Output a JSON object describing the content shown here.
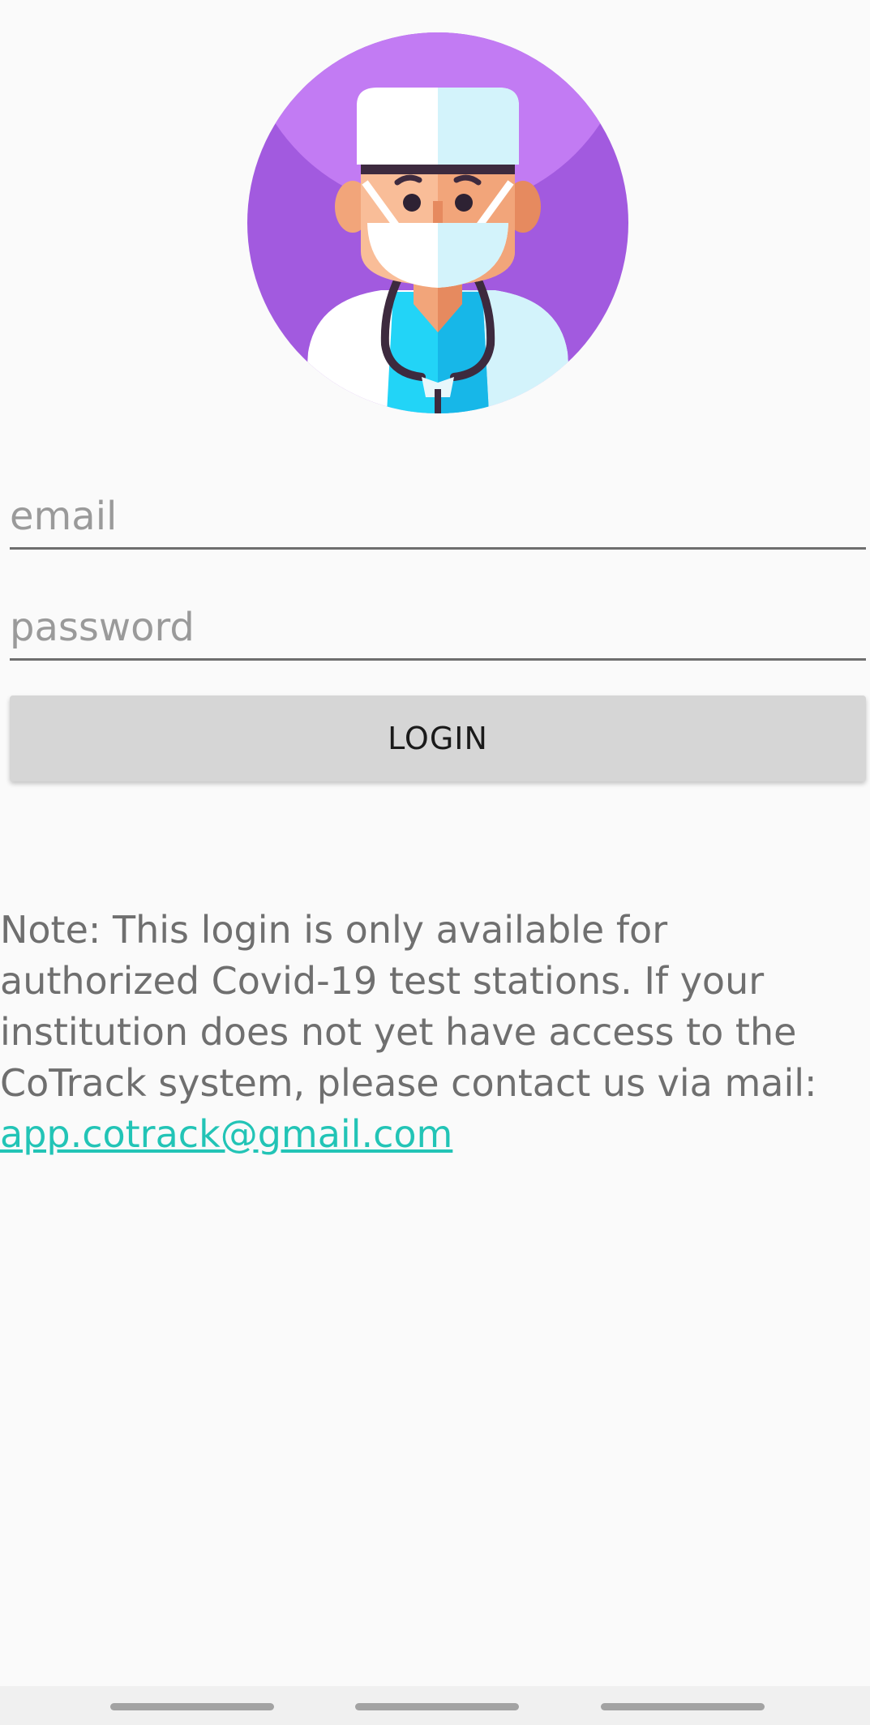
{
  "app": {
    "avatar_icon": "doctor-with-mask-icon"
  },
  "login_form": {
    "email_placeholder": "email",
    "password_placeholder": "password",
    "login_label": "LOGIN"
  },
  "note": {
    "text": "Note: This login is only available for authorized Covid-19 test stations. If your institution does not yet have access to the CoTrack system, please contact us via mail: ",
    "email_link": "app.cotrack@gmail.com"
  },
  "colors": {
    "avatar_background": "#a25adf",
    "link": "#22c4b6",
    "button_background": "#d6d6d6",
    "note_text": "#6f6f6f"
  }
}
